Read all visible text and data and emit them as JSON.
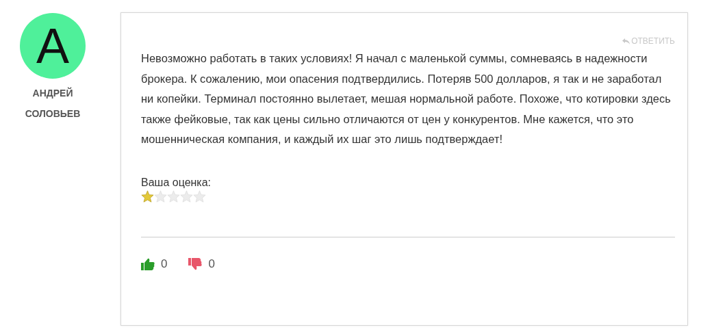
{
  "author": {
    "initial": "А",
    "first_name": "АНДРЕЙ",
    "last_name": "СОЛОВЬЕВ"
  },
  "review": {
    "reply": "ОТВЕТИТЬ",
    "text": "Невозможно работать в таких условиях! Я начал с маленькой суммы, сомневаясь в надежности брокера. К сожалению, мои опасения подтвердились. Потеряв 500 долларов, я так и не заработал ни копейки. Терминал постоянно вылетает, мешая нормальной работе. Похоже, что котировки здесь также фейковые, так как цены сильно отличаются от цен у конкурентов. Мне кажется, что это мошенническая компания, и каждый их шаг это лишь подтверждает!",
    "rating_label": "Ваша оценка:",
    "stars": 1,
    "likes": "0",
    "dislikes": "0"
  }
}
